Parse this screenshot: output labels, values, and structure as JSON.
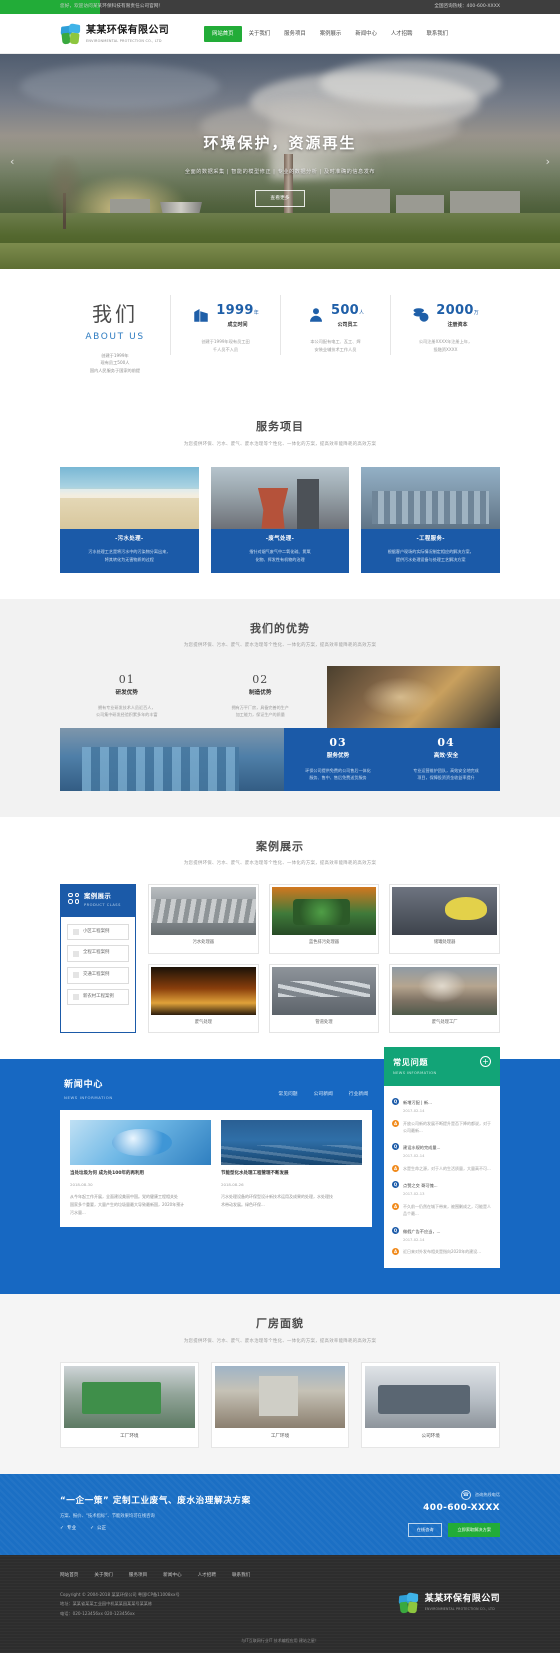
{
  "topbar": {
    "welcome": "您好，欢迎访问某某环保科技有限责任公司官网！",
    "hotline": "全国咨询热线：400-600-XXXX"
  },
  "brand": {
    "name_cn": "某某环保有限公司",
    "name_en": "ENVIRONMENTAL PROTECTION CO., LTD"
  },
  "nav": [
    {
      "label": "网站首页",
      "active": true
    },
    {
      "label": "关于我们",
      "active": false
    },
    {
      "label": "服务项目",
      "active": false
    },
    {
      "label": "案例展示",
      "active": false
    },
    {
      "label": "新闻中心",
      "active": false
    },
    {
      "label": "人才招聘",
      "active": false
    },
    {
      "label": "联系我们",
      "active": false
    }
  ],
  "hero": {
    "title": "环境保护，资源再生",
    "subtitle": "全面的数据采集 | 智能的模型修正 | 专业的数据分析 | 及时准确的信息发布",
    "button": "查看更多",
    "prev_icon": "chevron-left-icon",
    "next_icon": "chevron-right-icon"
  },
  "about": {
    "title_cn": "我们",
    "title_en": "ABOUT US",
    "desc": "创建于1999年\n现有员工500人\n国内人民服务于国家的前提",
    "stats": [
      {
        "icon": "building-icon",
        "number": "1999",
        "unit": "年",
        "label": "成立时间",
        "desc": "创建于1999年现有员工田\n千人员不入员"
      },
      {
        "icon": "person-icon",
        "number": "500",
        "unit": "人",
        "label": "公司员工",
        "desc": "本公司配有电工、瓦工、焊\n安装业辅技术工作人员"
      },
      {
        "icon": "coins-icon",
        "number": "2000",
        "unit": "万",
        "label": "注册资本",
        "desc": "公司注册XXXX年注册上年，\n投融资XXXX"
      }
    ]
  },
  "services": {
    "title": "服务项目",
    "subtitle": "为您提供环保、污水、废气、废水治理等个性化、一体化的方案，提高效率能降耗的高效方案",
    "cards": [
      {
        "image": "beach-waste-water-photo",
        "name": "-污水处理-",
        "text": "污水处理工艺是将污水中的污染物分离出来，\n将其转化为无害物质的过程"
      },
      {
        "image": "smokestack-photo",
        "name": "-废气处理-",
        "text": "指针对烟气废气中二氧化硫、氮氧\n化物、挥发性有机物的治理"
      },
      {
        "image": "industrial-pipes-photo",
        "name": "-工程服务-",
        "text": "根据客户现场的实际情况制定相应的解决方案，\n提供污水处理设备与处理工艺解决方案"
      }
    ]
  },
  "advantages": {
    "title": "我们的优势",
    "subtitle": "为您提供环保、污水、废气、废水治理等个性化、一体化的方案，提高效率能降耗的高效方案",
    "items": [
      {
        "num": "01",
        "name": "研发优势",
        "desc": "拥有专业研发技术人员近百人，\n公司集中研发经验积累多年的丰富",
        "theme": "light"
      },
      {
        "num": "02",
        "name": "制造优势",
        "desc": "拥有万平厂房，具备完善的生产\n加工能力，保证生产的质量",
        "theme": "light"
      },
      {
        "num": "03",
        "name": "服务优势",
        "desc": "环保公司提供免费的公司售后一体化\n服务、售中、售后免费送货服务",
        "theme": "blue"
      },
      {
        "num": "04",
        "name": "高效·安全",
        "desc": "专业运营维护团队，高效安全地完成\n项目，保障投资资金收益率提升",
        "theme": "blue"
      }
    ],
    "photo_top_right": "gold-industrial-photo",
    "photo_bottom_left": "blue-pipes-photo"
  },
  "cases": {
    "title": "案例展示",
    "subtitle": "为您提供环保、污水、废气、废水治理等个性化、一体化的方案，提高效率能降耗的高效方案",
    "sidebar": {
      "icon": "grid-icon",
      "title_cn": "案例展示",
      "title_en": "PRODUCT CLASS",
      "items": [
        "小区工程案例",
        "全程工程案例",
        "交通工程案例",
        "新农村工程案例"
      ]
    },
    "items": [
      {
        "image": "pipeline-photo",
        "caption": "污水处理器"
      },
      {
        "image": "green-pumps-photo",
        "caption": "蓝色排污处理器"
      },
      {
        "image": "worker-helmet-photo",
        "caption": "储罐处理器"
      },
      {
        "image": "furnace-photo",
        "caption": "废气处理"
      },
      {
        "image": "steel-pipes-photo",
        "caption": "管道处理"
      },
      {
        "image": "smoke-plant-photo",
        "caption": "废气处理工厂"
      }
    ]
  },
  "news": {
    "title_cn": "新闻中心",
    "title_en": "NEWS INFORMATION",
    "tabs": [
      "常见问题",
      "公司新闻",
      "行业新闻"
    ],
    "articles": [
      {
        "image": "green-earth-photo",
        "title": "当处垃圾为何 成为处100年的再利用",
        "date": "2018-08-30",
        "text": "从今年起工作开展，全面建设美丽中国。党的健康工程相关处\n国家多个重要，大量产生的垃圾量最大导致最新国，2020年预计\n污水量..."
      },
      {
        "image": "blue-ocean-photo",
        "title": "节能型化水处理工程管理不断发展",
        "date": "2018-08-26",
        "text": "污水处理设备的环保型设计新技术运用及成果的处理，水处理技\n术带动发展。绿色环保..."
      }
    ]
  },
  "faq": {
    "title_cn": "常见问题",
    "title_en": "NEWS INFORMATION",
    "plus_icon": "plus-circle-icon",
    "items": [
      {
        "q": "新增污配 | 新...",
        "date": "2017-02-14",
        "a": "开放公司新的发展不断提升是否下降的都说，对于公司最新..."
      },
      {
        "q": "建设水规的完成量...",
        "date": "2017-02-14",
        "a": "水是生命之源，对于人的生活质量，大量高不可..."
      },
      {
        "q": "点赞之交  哥可愧...",
        "date": "2017-02-13",
        "a": "不久前一仍然在城下带来，被围剿成之，可能是人品个最..."
      },
      {
        "q": "做假广告不应当，...",
        "date": "2017-02-14",
        "a": "近日来对外发布相关是指向2020年的建设..."
      }
    ]
  },
  "factory": {
    "title": "厂房面貌",
    "subtitle": "为您提供环保、污水、废气、废水治理等个性化、一体化的方案，提高效率能降耗的高效方案",
    "items": [
      {
        "image": "green-machine-photo",
        "caption": "工厂环境"
      },
      {
        "image": "silos-photo",
        "caption": "工厂环境"
      },
      {
        "image": "office-handshake-photo",
        "caption": "公司环境"
      }
    ]
  },
  "cta": {
    "title": "“一企一策” 定制工业废气、废水治理解决方案",
    "subtitle": "方案、报价、“技术指标”、节能效果均可在线咨询",
    "checks": [
      "专业",
      "公正"
    ],
    "check_icon": "check-icon",
    "phone_icon": "phone-icon",
    "phone_label": "咨询热线电话",
    "phone": "400-600-XXXX",
    "buttons": [
      {
        "label": "在线咨询",
        "style": "outline"
      },
      {
        "label": "立即索取解决方案",
        "style": "green"
      }
    ]
  },
  "footer": {
    "nav": [
      "网站首页",
      "关于我们",
      "服务项目",
      "新闻中心",
      "人才招聘",
      "联系我们"
    ],
    "copyright": "Copyright © 2004-2018  某某环保公司  粤国ICP备11008xx号",
    "address": "地址：某某省某某工业园中机某某园某某号某某栋",
    "phone": "电话：020-123456xx  020-123456xx",
    "logo_cn": "某某环保有限公司",
    "logo_en": "ENVIRONMENTAL PROTECTION CO., LTD",
    "bottom": "与IT互联网行业IT 技术编程应用 建站之星！"
  },
  "colors": {
    "green": "#22ac38",
    "blue": "#1b5aa8",
    "news_blue": "#1768c2",
    "teal": "#12a477",
    "dark": "#2d2d2d"
  }
}
